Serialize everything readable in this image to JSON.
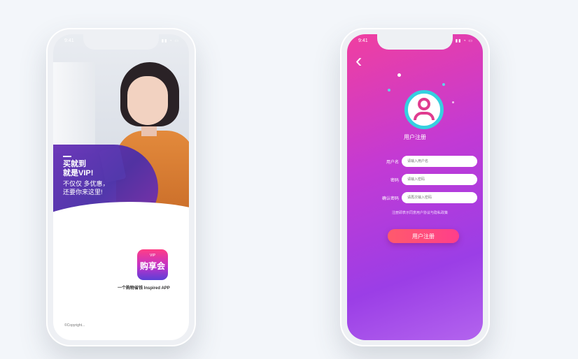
{
  "left_phone": {
    "status_time": "9:41",
    "status_icons": "▮▮ ◔ ▭",
    "promo": {
      "line1": "买就到",
      "line2": "就是VIP!",
      "line3": "不仅仅 多优惠，",
      "line4": "还要你来这里!"
    },
    "app_logo": {
      "top_text": "VIP",
      "main_text": "购享会"
    },
    "tagline": "一个购物省钱 Inspired APP",
    "footer": "©Copyright..."
  },
  "right_phone": {
    "status_time": "9:41",
    "status_icons": "▮▮ ◔ ▭",
    "back_icon": "chevron-left",
    "avatar_label": "用户注册",
    "form": [
      {
        "label": "用户名",
        "placeholder": "请输入用户名"
      },
      {
        "label": "密码",
        "placeholder": "请输入密码"
      },
      {
        "label": "确认密码",
        "placeholder": "请再次输入密码"
      }
    ],
    "hint": "注册即表示同意用户协议与隐私政策",
    "register_label": "用户注册"
  },
  "colors": {
    "background": "#f3f6fa",
    "gradient_pink": "#f03fa0",
    "gradient_purple": "#9b3ee6",
    "avatar_ring": "#35d0e0",
    "button": "#ff3e8a"
  }
}
